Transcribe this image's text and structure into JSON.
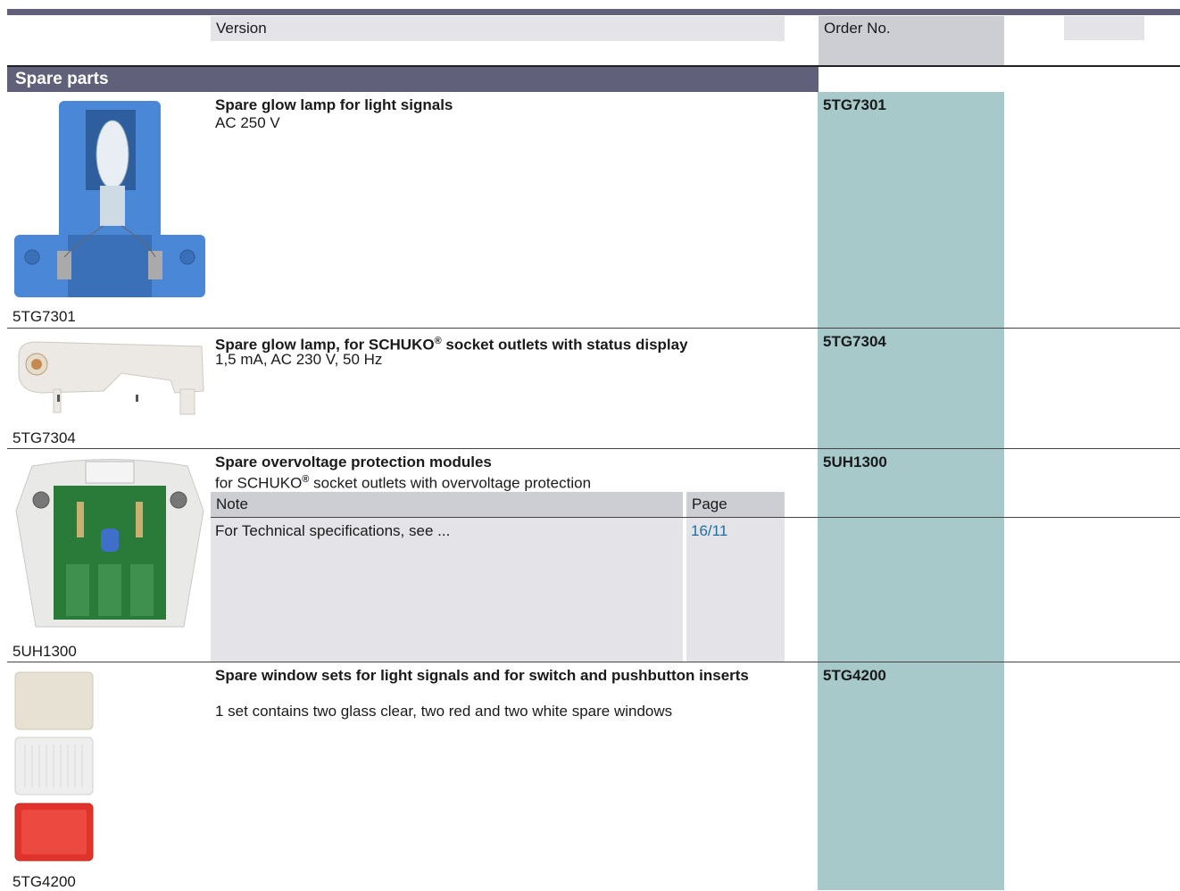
{
  "header": {
    "version_label": "Version",
    "order_label": "Order No."
  },
  "section": {
    "title": "Spare parts"
  },
  "rows": [
    {
      "image_caption": "5TG7301",
      "title": "Spare glow lamp for light signals",
      "subtitle": "AC 250 V",
      "order_no": "5TG7301"
    },
    {
      "image_caption": "5TG7304",
      "title_pre": "Spare glow lamp, for SCHUKO",
      "title_reg": "®",
      "title_post": " socket outlets with status display",
      "subtitle": "1,5 mA, AC 230 V, 50 Hz",
      "order_no": "5TG7304"
    },
    {
      "image_caption": "5UH1300",
      "title": "Spare overvoltage protection modules",
      "subtitle_pre": "for SCHUKO",
      "subtitle_reg": "®",
      "subtitle_post": " socket outlets with overvoltage protection",
      "order_no": "5UH1300",
      "note_table": {
        "col_note": "Note",
        "col_page": "Page",
        "note_text": "For Technical specifications, see ...",
        "page_link": "16/11"
      }
    },
    {
      "image_caption": "5TG4200",
      "title": "Spare window sets for light signals and for switch and pushbutton inserts",
      "subtitle": "1 set contains two glass clear, two red and two white spare windows",
      "order_no": "5TG4200"
    }
  ],
  "colors": {
    "band": "#60607a",
    "order_column": "#a7c9ca",
    "header_gray": "#e3e3e8",
    "link": "#1f6fa0"
  }
}
